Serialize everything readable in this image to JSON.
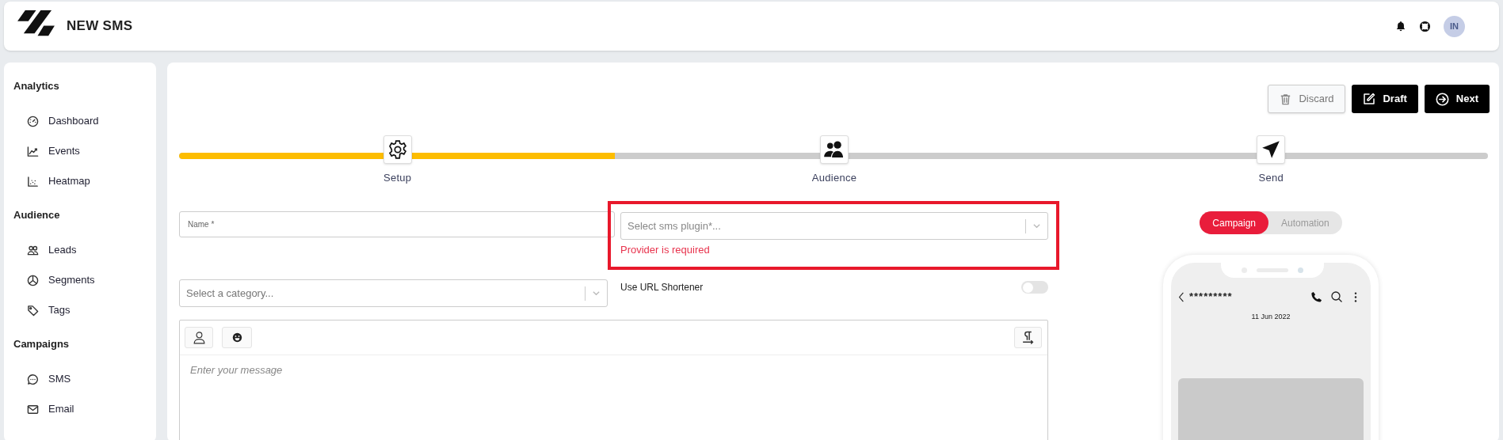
{
  "header": {
    "title": "NEW SMS",
    "avatar_initials": "IN"
  },
  "sidebar": {
    "sections": [
      {
        "title": "Analytics",
        "items": [
          {
            "label": "Dashboard",
            "kind": "gauge"
          },
          {
            "label": "Events",
            "kind": "trend"
          },
          {
            "label": "Heatmap",
            "kind": "scatter"
          }
        ]
      },
      {
        "title": "Audience",
        "items": [
          {
            "label": "Leads",
            "kind": "people"
          },
          {
            "label": "Segments",
            "kind": "pie"
          },
          {
            "label": "Tags",
            "kind": "tag"
          }
        ]
      },
      {
        "title": "Campaigns",
        "items": [
          {
            "label": "SMS",
            "kind": "chat"
          },
          {
            "label": "Email",
            "kind": "mail"
          }
        ]
      }
    ]
  },
  "actions": [
    {
      "label": "Discard",
      "kind": "discard"
    },
    {
      "label": "Draft",
      "kind": "draft"
    },
    {
      "label": "Next",
      "kind": "next"
    }
  ],
  "progress": {
    "level": 0.333,
    "steps": [
      {
        "label": "Setup",
        "kind": "gear"
      },
      {
        "label": "Audience",
        "kind": "people"
      },
      {
        "label": "Send",
        "kind": "send"
      }
    ]
  },
  "form": {
    "name_field": {
      "placeholder": "Name *"
    },
    "plugin_select": {
      "placeholder": "Select sms plugin*...",
      "error": "Provider is required",
      "highlighted": true
    },
    "category_select": {
      "placeholder": "Select a category..."
    },
    "url_shortener": {
      "label": "Use URL Shortener",
      "on": false
    },
    "message": {
      "placeholder": "Enter your message"
    }
  },
  "preview": {
    "modes": [
      {
        "label": "Campaign",
        "selected": true
      },
      {
        "label": "Automation",
        "selected": false
      }
    ],
    "phone": {
      "contact": "*********",
      "date": "11 Jun 2022"
    }
  }
}
